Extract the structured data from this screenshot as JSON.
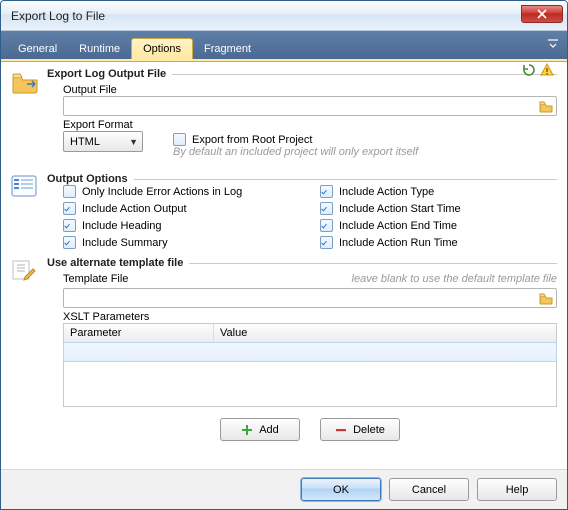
{
  "window": {
    "title": "Export Log to File"
  },
  "tabs": {
    "items": [
      "General",
      "Runtime",
      "Options",
      "Fragment"
    ],
    "activeIndex": 2,
    "menuHint": "▾"
  },
  "section_output": {
    "title": "Export Log Output File",
    "outputFile": {
      "label": "Output File",
      "value": ""
    },
    "exportFormat": {
      "label": "Export Format",
      "value": "HTML"
    },
    "exportRoot": {
      "label": "Export from Root Project",
      "checked": false,
      "hint": "By default an included project will only export itself"
    }
  },
  "section_options": {
    "title": "Output Options",
    "checks": [
      {
        "label": "Only Include Error Actions in Log",
        "checked": false
      },
      {
        "label": "Include Action Type",
        "checked": true
      },
      {
        "label": "Include Action Output",
        "checked": true
      },
      {
        "label": "Include Action Start Time",
        "checked": true
      },
      {
        "label": "Include Heading",
        "checked": true
      },
      {
        "label": "Include Action End Time",
        "checked": true
      },
      {
        "label": "Include Summary",
        "checked": true
      },
      {
        "label": "Include Action Run Time",
        "checked": true
      }
    ]
  },
  "section_template": {
    "title": "Use alternate template file",
    "templateFile": {
      "label": "Template File",
      "value": "",
      "hint": "leave blank to use the default template file"
    },
    "params": {
      "label": "XSLT Parameters",
      "columns": [
        "Parameter",
        "Value"
      ],
      "rows": [
        {
          "parameter": "",
          "value": ""
        }
      ]
    },
    "buttons": {
      "add": "Add",
      "delete": "Delete"
    }
  },
  "footer": {
    "ok": "OK",
    "cancel": "Cancel",
    "help": "Help"
  }
}
